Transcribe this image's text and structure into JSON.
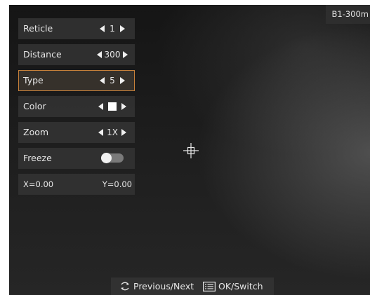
{
  "badge": "B1-300m",
  "menu": {
    "reticle": {
      "label": "Reticle",
      "value": "1"
    },
    "distance": {
      "label": "Distance",
      "value": "300"
    },
    "type": {
      "label": "Type",
      "value": "5"
    },
    "color": {
      "label": "Color",
      "value_color": "#ffffff"
    },
    "zoom": {
      "label": "Zoom",
      "value": "1X"
    },
    "freeze": {
      "label": "Freeze",
      "enabled": false
    },
    "coords": {
      "x": "X=0.00",
      "y": "Y=0.00"
    }
  },
  "hints": {
    "prev_next": "Previous/Next",
    "ok_switch": "OK/Switch"
  },
  "colors": {
    "selection_border": "#c8813a",
    "panel_bg": "#343434",
    "text": "#e6e6e6"
  }
}
